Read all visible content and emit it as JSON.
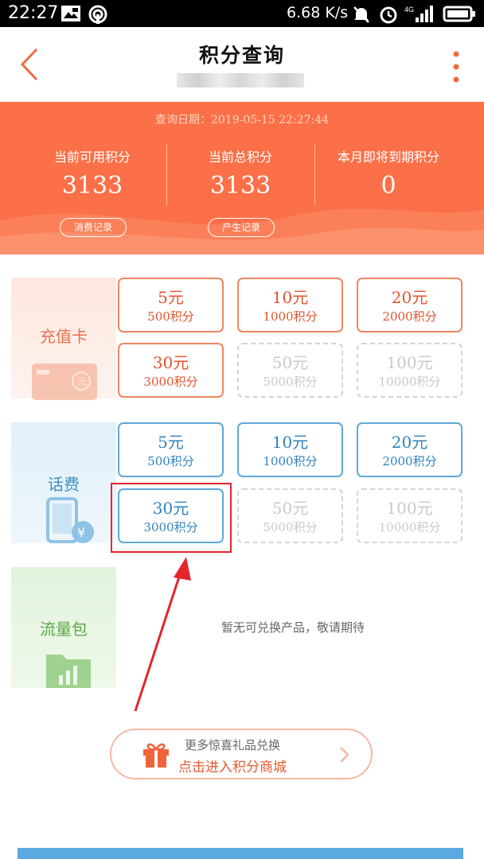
{
  "status_bar": {
    "time": "22:27",
    "speed": "6.68 K/s",
    "network": "4G"
  },
  "header": {
    "title": "积分查询"
  },
  "summary": {
    "query_date": "查询日期：2019-05-15 22:27:44",
    "stats": [
      {
        "label": "当前可用积分",
        "value": "3133"
      },
      {
        "label": "当前总积分",
        "value": "3133"
      },
      {
        "label": "本月即将到期积分",
        "value": "0"
      }
    ],
    "consume_record": "消费记录",
    "produce_record": "产生记录"
  },
  "categories": [
    {
      "name": "充值卡",
      "options": [
        {
          "amount": "5元",
          "points": "500积分",
          "enabled": true
        },
        {
          "amount": "10元",
          "points": "1000积分",
          "enabled": true
        },
        {
          "amount": "20元",
          "points": "2000积分",
          "enabled": true
        },
        {
          "amount": "30元",
          "points": "3000积分",
          "enabled": true
        },
        {
          "amount": "50元",
          "points": "5000积分",
          "enabled": false
        },
        {
          "amount": "100元",
          "points": "10000积分",
          "enabled": false
        }
      ]
    },
    {
      "name": "话费",
      "options": [
        {
          "amount": "5元",
          "points": "500积分",
          "enabled": true
        },
        {
          "amount": "10元",
          "points": "1000积分",
          "enabled": true
        },
        {
          "amount": "20元",
          "points": "2000积分",
          "enabled": true
        },
        {
          "amount": "30元",
          "points": "3000积分",
          "enabled": true
        },
        {
          "amount": "50元",
          "points": "5000积分",
          "enabled": false
        },
        {
          "amount": "100元",
          "points": "10000积分",
          "enabled": false
        }
      ]
    },
    {
      "name": "流量包",
      "empty_text": "暂无可兑换产品，敬请期待"
    }
  ],
  "mall": {
    "line1": "更多惊喜礼品兑换",
    "line2": "点击进入积分商城"
  },
  "icons": {
    "back": "back-arrow-icon",
    "more": "more-vertical-icon",
    "gift": "gift-icon",
    "chevron": "chevron-right-icon"
  },
  "colors": {
    "accent": "#fb7048",
    "card_orange": "#e2532c",
    "phone_blue": "#2f83bd",
    "data_green": "#5aa646",
    "highlight": "#e3262e"
  }
}
